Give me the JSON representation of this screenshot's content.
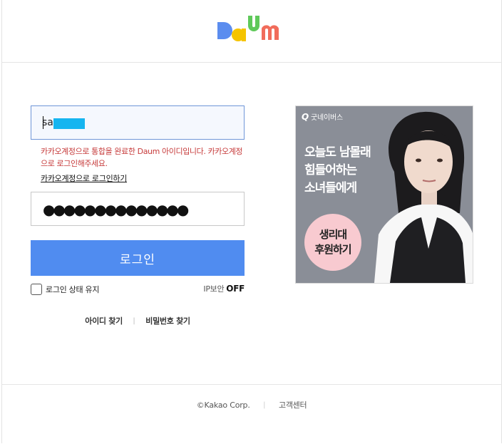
{
  "header": {
    "logo_text": "Daum",
    "logo_colors": {
      "D": "#5b8def",
      "a": "#f5c400",
      "u": "#5fc95a",
      "m": "#f16c5b"
    }
  },
  "login": {
    "id_value": "sa",
    "error_message": "카카오계정으로 통합을 완료한 Daum 아이디입니다. 카카오계정으로 로그인해주세요.",
    "kakao_login_link": "카카오계정으로 로그인하기",
    "password_mask": "●●●●●●●●●●●●●●",
    "login_button": "로그인",
    "keep_login_label": "로그인 상태 유지",
    "ip_security_label": "IP보안",
    "ip_security_value": "OFF",
    "ip_security_on": false,
    "keep_login_checked": false
  },
  "find": {
    "find_id": "아이디 찾기",
    "find_password": "비밀번호 찾기"
  },
  "ad": {
    "brand": "굿네이버스",
    "brand_mark": "Q",
    "headline": "오늘도 남몰래\n힘들어하는\n소녀들에게",
    "cta": "생리대\n후원하기"
  },
  "footer": {
    "copyright": "©Kakao Corp.",
    "help_center": "고객센터"
  },
  "colors": {
    "primary_button": "#508cf0",
    "error_text": "#c63a3a",
    "id_field_border": "#6f96d8",
    "ad_background": "#8a8e97",
    "ad_cta": "#f8cad0"
  }
}
